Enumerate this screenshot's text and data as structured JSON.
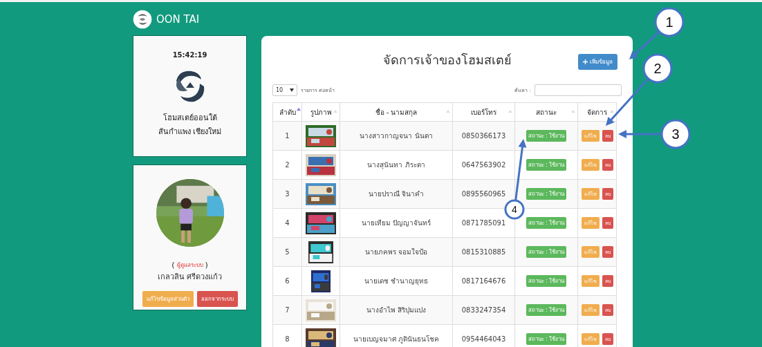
{
  "brand": {
    "name": "OON TAI"
  },
  "info_card": {
    "clock": "15:42:19",
    "title": "โฮมสเตย์ออนใต้",
    "subtitle": "สันกำแพง เชียงใหม่"
  },
  "profile_card": {
    "role_line": [
      "(",
      "ผู้ดูแลระบบ",
      ")"
    ],
    "name": "เกลวลิน ศรีดวงแก้ว",
    "buttons": [
      {
        "label": "แก้ไขข้อมูลส่วนตัว",
        "kind": "warning"
      },
      {
        "label": "ออกจากระบบ",
        "kind": "danger"
      }
    ]
  },
  "main": {
    "title": "จัดการเจ้าของโฮมสเตย์",
    "add_button": "เพิ่มข้อมูล",
    "page_length": {
      "value": "10",
      "label": "รายการ ต่อหน้า"
    },
    "search": {
      "label": "ค้นหา :"
    },
    "table": {
      "columns": [
        {
          "label": "ลำดับ",
          "sorted": true
        },
        {
          "label": "รูปภาพ",
          "sorted": false
        },
        {
          "label": "ชื่อ - นามสกุล",
          "sorted": false
        },
        {
          "label": "เบอร์โทร",
          "sorted": false
        },
        {
          "label": "สถานะ",
          "sorted": false
        },
        {
          "label": "จัดการ",
          "sorted": false
        }
      ],
      "rows": [
        {
          "no": "1",
          "name": "นางสาวกาญจนา นันตา",
          "phone": "0850366173",
          "status": "สถานะ : ใช้งาน",
          "active": true,
          "edit": "แก้ไข",
          "delete": "ลบ"
        },
        {
          "no": "2",
          "name": "นางสุนันทา ภิระตา",
          "phone": "0647563902",
          "status": "สถานะ : ใช้งาน",
          "active": true,
          "edit": "แก้ไข",
          "delete": "ลบ"
        },
        {
          "no": "3",
          "name": "นายปราณี จินาคำ",
          "phone": "0895560965",
          "status": "สถานะ : ใช้งาน",
          "active": true,
          "edit": "แก้ไข",
          "delete": "ลบ"
        },
        {
          "no": "4",
          "name": "นายเทียม ปัญญาจันทร์",
          "phone": "0871785091",
          "status": "สถานะ : ใช้งาน",
          "active": true,
          "edit": "แก้ไข",
          "delete": "ลบ"
        },
        {
          "no": "5",
          "name": "นายภคพร จอมใจป้อ",
          "phone": "0815310885",
          "status": "สถานะ : ใช้งาน",
          "active": true,
          "edit": "แก้ไข",
          "delete": "ลบ"
        },
        {
          "no": "6",
          "name": "นายเดช ชำนาญยุทธ",
          "phone": "0817164676",
          "status": "สถานะ : ใช้งาน",
          "active": true,
          "edit": "แก้ไข",
          "delete": "ลบ"
        },
        {
          "no": "7",
          "name": "นางอำไพ สิริปุมแปง",
          "phone": "0833247354",
          "status": "สถานะ : ใช้งาน",
          "active": true,
          "edit": "แก้ไข",
          "delete": "ลบ"
        },
        {
          "no": "8",
          "name": "นายเบญจมาศ ภูดินันธนโชค",
          "phone": "0954464043",
          "status": "สถานะ : ใช้งาน",
          "active": true,
          "edit": "แก้ไข",
          "delete": "ลบ"
        }
      ]
    }
  },
  "annotations": [
    {
      "label": "1"
    },
    {
      "label": "2"
    },
    {
      "label": "3"
    },
    {
      "label": "4"
    }
  ]
}
